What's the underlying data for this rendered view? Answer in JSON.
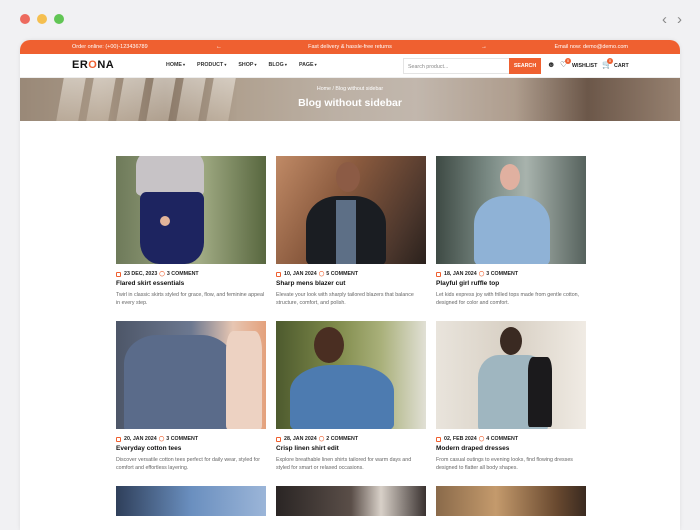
{
  "colors": {
    "accent": "#ef6030",
    "traffic_red": "#ed6a5e",
    "traffic_yellow": "#f5bf4f",
    "traffic_green": "#61c554"
  },
  "topbar": {
    "order_online": "Order online: (+00)-123436789",
    "promo": "Fast delivery & hassle-free returns",
    "email": "Email now: demo@demo.com"
  },
  "header": {
    "logo_prefix": "ER",
    "logo_o": "O",
    "logo_suffix": "NA",
    "menu": [
      "HOME",
      "PRODUCT",
      "SHOP",
      "BLOG",
      "PAGE"
    ],
    "search_placeholder": "Search product...",
    "search_button": "SEARCH",
    "wishlist_label": "WISHLIST",
    "wishlist_count": "0",
    "cart_label": "CART",
    "cart_count": "0"
  },
  "hero": {
    "breadcrumb": "Home / Blog without sidebar",
    "title": "Blog without sidebar"
  },
  "posts": [
    {
      "date": "23 DEC, 2023",
      "comments": "3 COMMENT",
      "title": "Flared skirt essentials",
      "desc": "Twirl in classic skirts styled for grace, flow, and feminine appeal in every step."
    },
    {
      "date": "10, JAN 2024",
      "comments": "5 COMMENT",
      "title": "Sharp mens blazer cut",
      "desc": "Elevate your look with sharply tailored blazers that balance structure, comfort, and polish."
    },
    {
      "date": "18, JAN 2024",
      "comments": "3 COMMENT",
      "title": "Playful girl ruffle top",
      "desc": "Let kids express joy with frilled tops made from gentle cotton, designed for color and comfort."
    },
    {
      "date": "20, JAN 2024",
      "comments": "3 COMMENT",
      "title": "Everyday cotton tees",
      "desc": "Discover versatile cotton tees perfect for daily wear, styled for comfort and effortless layering."
    },
    {
      "date": "28, JAN 2024",
      "comments": "2 COMMENT",
      "title": "Crisp linen shirt edit",
      "desc": "Explore breathable linen shirts tailored for warm days and styled for smart or relaxed occasions."
    },
    {
      "date": "02, FEB 2024",
      "comments": "4 COMMENT",
      "title": "Modern draped dresses",
      "desc": "From casual outings to evening looks, find flowing dresses designed to flatter all body shapes."
    }
  ]
}
